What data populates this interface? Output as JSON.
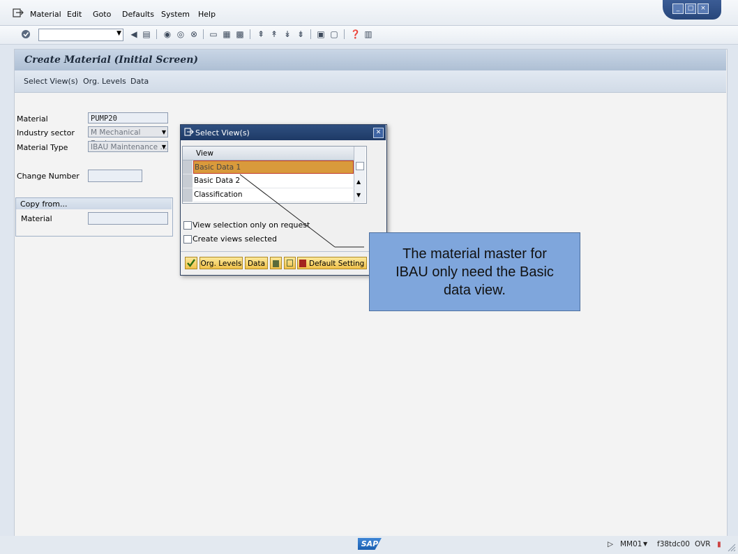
{
  "menu": {
    "items": [
      "Material",
      "Edit",
      "Goto",
      "Defaults",
      "System",
      "Help"
    ]
  },
  "window_controls": [
    "minimize",
    "maximize",
    "close"
  ],
  "page": {
    "title": "Create Material (Initial Screen)",
    "app_toolbar": [
      "Select View(s)",
      "Org. Levels",
      "Data"
    ]
  },
  "form": {
    "material_label": "Material",
    "material_value": "PUMP20",
    "industry_label": "Industry sector",
    "industry_value": "M Mechanical Engin...",
    "type_label": "Material Type",
    "type_value": "IBAU Maintenance ...",
    "change_number_label": "Change Number",
    "change_number_value": "",
    "copy_from_title": "Copy from...",
    "copy_material_label": "Material",
    "copy_material_value": ""
  },
  "dialog": {
    "title": "Select View(s)",
    "column_header": "View",
    "rows": [
      {
        "label": "Basic Data 1",
        "selected": true
      },
      {
        "label": "Basic Data 2",
        "selected": false
      },
      {
        "label": "Classification",
        "selected": false
      }
    ],
    "options": [
      {
        "label": "View selection only on request",
        "checked": false
      },
      {
        "label": "Create views selected",
        "checked": false
      }
    ],
    "buttons": {
      "org_levels": "Org. Levels",
      "data": "Data",
      "default_setting": "Default Setting"
    }
  },
  "callout": {
    "line1": "The material master for",
    "line2": "IBAU only need the Basic",
    "line3": "data view."
  },
  "status": {
    "logo": "SAP",
    "transaction": "MM01",
    "server": "f38tdc00",
    "mode": "OVR"
  },
  "colors": {
    "selection": "#d99a3b",
    "callout": "#7fa6dc",
    "dialog_title": "#1e3a66",
    "button": "#f0c14a"
  }
}
